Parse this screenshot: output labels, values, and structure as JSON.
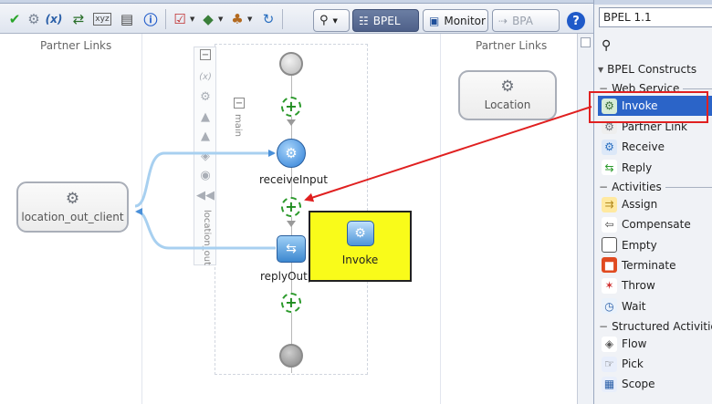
{
  "toolbar": {
    "icons": [
      "validate-check-icon",
      "gear-icon",
      "variables-icon",
      "partner-link-icon",
      "xml-icon",
      "schema-icon",
      "info-icon",
      "task-icon",
      "deploy-icon",
      "test-icon",
      "refresh-icon"
    ],
    "views": {
      "search_icon": "binoculars-icon",
      "bpel_label": "BPEL",
      "monitor_label": "Monitor",
      "bpa_label": "BPA"
    },
    "help_label": "?"
  },
  "canvas": {
    "left_lane_label": "Partner Links",
    "right_lane_label": "Partner Links",
    "scope_label": "main",
    "sequence_label": "location_out",
    "left_partner": "location_out_client",
    "right_partner": "Location",
    "receive_label": "receiveInput",
    "reply_label": "replyOutp",
    "drag_label": "Invoke"
  },
  "palette": {
    "version": "BPEL 1.1",
    "constructs_label": "BPEL Constructs",
    "web_service_group": "Web Service",
    "web_service_items": [
      {
        "label": "Invoke",
        "icon": "invoke-icon",
        "selected": true
      },
      {
        "label": "Partner Link",
        "icon": "partner-link-icon",
        "selected": false
      },
      {
        "label": "Receive",
        "icon": "receive-icon",
        "selected": false
      },
      {
        "label": "Reply",
        "icon": "reply-icon",
        "selected": false
      }
    ],
    "activities_group": "Activities",
    "activities_items": [
      {
        "label": "Assign",
        "icon": "assign-icon"
      },
      {
        "label": "Compensate",
        "icon": "compensate-icon"
      },
      {
        "label": "Empty",
        "icon": "empty-icon"
      },
      {
        "label": "Terminate",
        "icon": "terminate-icon"
      },
      {
        "label": "Throw",
        "icon": "throw-icon"
      },
      {
        "label": "Wait",
        "icon": "wait-icon"
      }
    ],
    "structured_group": "Structured Activities",
    "structured_items": [
      {
        "label": "Flow",
        "icon": "flow-icon"
      },
      {
        "label": "Pick",
        "icon": "pick-icon"
      },
      {
        "label": "Scope",
        "icon": "scope-icon"
      }
    ]
  },
  "colors": {
    "highlight_red": "#e02020",
    "drag_yellow": "#f9fb1a",
    "selection_blue": "#2b64c8",
    "connector_blue": "#a8d0f0"
  }
}
